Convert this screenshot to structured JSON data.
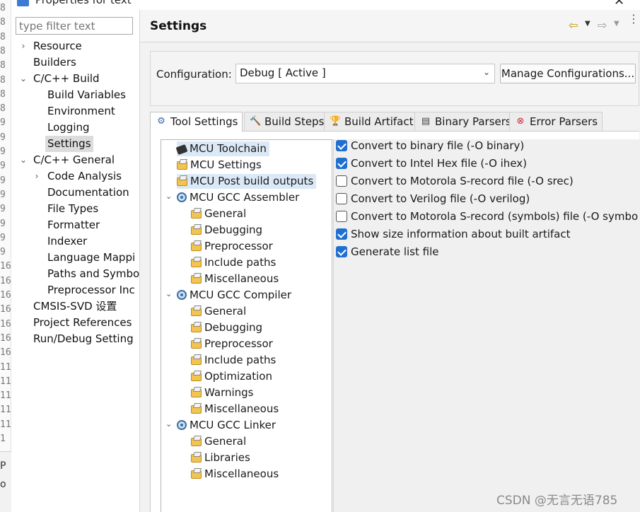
{
  "window": {
    "title": "Properties for text",
    "close_glyph": "✕"
  },
  "gutter": {
    "lines": [
      "8",
      "8",
      "8",
      "8",
      "8",
      "8",
      "8",
      "8",
      "9",
      "9",
      "9",
      "9",
      "9",
      "9",
      "9",
      "9",
      "9",
      "9",
      "16",
      "16",
      "16",
      "16",
      "16",
      "16",
      "16",
      "11",
      "11",
      "11",
      "11",
      "11",
      "1"
    ],
    "bottom": [
      "P",
      "o"
    ]
  },
  "filter": {
    "placeholder": "type filter text"
  },
  "nav": {
    "items": [
      {
        "label": "Resource",
        "expander": "›"
      },
      {
        "label": "Builders"
      },
      {
        "label": "C/C++ Build",
        "expander": "⌄"
      },
      {
        "label": "Build Variables"
      },
      {
        "label": "Environment"
      },
      {
        "label": "Logging"
      },
      {
        "label": "Settings",
        "selected": true
      },
      {
        "label": "C/C++ General",
        "expander": "⌄"
      },
      {
        "label": "Code Analysis",
        "expander": "›"
      },
      {
        "label": "Documentation"
      },
      {
        "label": "File Types"
      },
      {
        "label": "Formatter"
      },
      {
        "label": "Indexer"
      },
      {
        "label": "Language Mappi"
      },
      {
        "label": "Paths and Symbo"
      },
      {
        "label": "Preprocessor Inc"
      },
      {
        "label": "CMSIS-SVD 设置"
      },
      {
        "label": "Project References"
      },
      {
        "label": "Run/Debug Setting"
      }
    ]
  },
  "header": {
    "title": "Settings",
    "back_icon": "arrow-left-icon",
    "forward_icon": "arrow-right-icon",
    "back_glyph": "⇦",
    "forward_glyph": "⇨",
    "dropdown_glyph": "▼",
    "more_glyph": "⋮"
  },
  "configuration": {
    "label": "Configuration:",
    "value": "Debug  [ Active ]",
    "arrow": "⌄",
    "manage_label": "Manage Configurations..."
  },
  "tabs": [
    {
      "label": "Tool Settings",
      "icon": "gear-icon",
      "glyph": "⚙",
      "active": true
    },
    {
      "label": "Build Steps",
      "icon": "hammer-icon",
      "glyph": "🔨"
    },
    {
      "label": "Build Artifact",
      "icon": "trophy-icon",
      "glyph": "🏆"
    },
    {
      "label": "Binary Parsers",
      "icon": "binary-icon",
      "glyph": "▤"
    },
    {
      "label": "Error Parsers",
      "icon": "error-icon",
      "glyph": "⊗"
    }
  ],
  "tool_tree": [
    {
      "label": "MCU Toolchain",
      "icon": "chip"
    },
    {
      "label": "MCU Settings",
      "icon": "folder"
    },
    {
      "label": "MCU Post build outputs",
      "icon": "folder"
    },
    {
      "label": "MCU GCC Assembler",
      "icon": "gear",
      "expander": "⌄"
    },
    {
      "label": "General",
      "icon": "folder"
    },
    {
      "label": "Debugging",
      "icon": "folder"
    },
    {
      "label": "Preprocessor",
      "icon": "folder"
    },
    {
      "label": "Include paths",
      "icon": "folder"
    },
    {
      "label": "Miscellaneous",
      "icon": "folder"
    },
    {
      "label": "MCU GCC Compiler",
      "icon": "gear",
      "expander": "⌄"
    },
    {
      "label": "General",
      "icon": "folder"
    },
    {
      "label": "Debugging",
      "icon": "folder"
    },
    {
      "label": "Preprocessor",
      "icon": "folder"
    },
    {
      "label": "Include paths",
      "icon": "folder"
    },
    {
      "label": "Optimization",
      "icon": "folder"
    },
    {
      "label": "Warnings",
      "icon": "folder"
    },
    {
      "label": "Miscellaneous",
      "icon": "folder"
    },
    {
      "label": "MCU GCC Linker",
      "icon": "gear",
      "expander": "⌄"
    },
    {
      "label": "General",
      "icon": "folder"
    },
    {
      "label": "Libraries",
      "icon": "folder"
    },
    {
      "label": "Miscellaneous",
      "icon": "folder"
    }
  ],
  "options": [
    {
      "label": "Convert to binary file (-O binary)",
      "checked": true
    },
    {
      "label": "Convert to Intel Hex file (-O ihex)",
      "checked": true
    },
    {
      "label": "Convert to Motorola S-record file (-O srec)",
      "checked": false
    },
    {
      "label": "Convert to Verilog file (-O verilog)",
      "checked": false
    },
    {
      "label": "Convert to Motorola S-record (symbols) file (-O symbo",
      "checked": false
    },
    {
      "label": "Show size information about built artifact",
      "checked": true
    },
    {
      "label": "Generate list file",
      "checked": true
    }
  ],
  "watermark": "CSDN @无言无语785"
}
